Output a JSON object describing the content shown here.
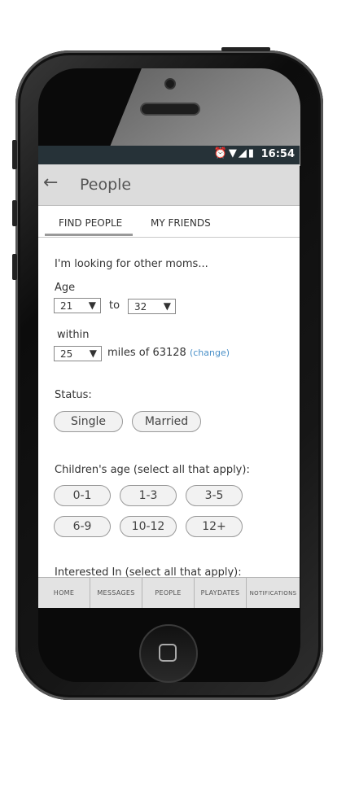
{
  "status_bar": {
    "time": "16:54",
    "icons": [
      "alarm-icon",
      "wifi-icon",
      "signal-icon",
      "battery-icon"
    ]
  },
  "app_bar": {
    "title": "People"
  },
  "tabs": [
    {
      "label": "FIND PEOPLE",
      "active": true
    },
    {
      "label": "MY FRIENDS",
      "active": false
    }
  ],
  "form": {
    "intro": "I'm looking for other moms...",
    "age_label": "Age",
    "age_from": "21",
    "age_to_word": "to",
    "age_to": "32",
    "within_label": "within",
    "distance": "25",
    "miles_text": "miles of 63128",
    "change_link": "(change)",
    "status_label": "Status:",
    "status_options": [
      "Single",
      "Married"
    ],
    "children_label": "Children's age (select all that apply):",
    "children_options": [
      "0-1",
      "1-3",
      "3-5",
      "6-9",
      "10-12",
      "12+"
    ],
    "interested_label": "Interested In (select all that apply):"
  },
  "bottom_nav": [
    "HOME",
    "MESSAGES",
    "PEOPLE",
    "PLAYDATES",
    "NOTIFICATIONS"
  ],
  "colors": {
    "status_bar": "#263238",
    "app_bar": "#dcdcdc",
    "link": "#4a90c8"
  }
}
